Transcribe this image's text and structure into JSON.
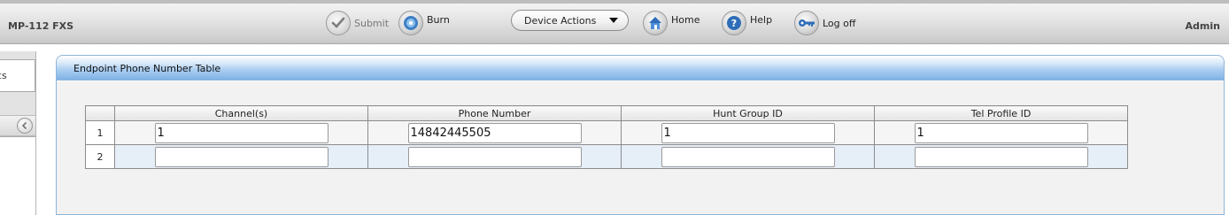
{
  "header": {
    "product": "MP-112 FXS",
    "user": "Admin",
    "submit_label": "Submit",
    "burn_label": "Burn",
    "device_actions_label": "Device Actions",
    "home_label": "Home",
    "help_label": "Help",
    "logoff_label": "Log off"
  },
  "sidebar": {
    "tab_label": "cs"
  },
  "panel": {
    "title": "Endpoint Phone Number Table"
  },
  "table": {
    "columns": [
      "Channel(s)",
      "Phone Number",
      "Hunt Group ID",
      "Tel Profile ID"
    ],
    "rows": [
      {
        "index": "1",
        "channels": "1",
        "phone": "14842445505",
        "hunt_group": "1",
        "tel_profile": "1"
      },
      {
        "index": "2",
        "channels": "",
        "phone": "",
        "hunt_group": "",
        "tel_profile": ""
      }
    ]
  },
  "colors": {
    "panel_header_blue": "#7fb2e6",
    "row_alt_blue": "#e6eef8",
    "toolbar_gray": "#d8d8d8"
  },
  "icons": {
    "submit": "checkmark-icon",
    "burn": "burn-disc-icon",
    "home": "home-icon",
    "help": "help-question-icon",
    "logoff": "key-icon",
    "collapse": "chevron-left-icon"
  }
}
